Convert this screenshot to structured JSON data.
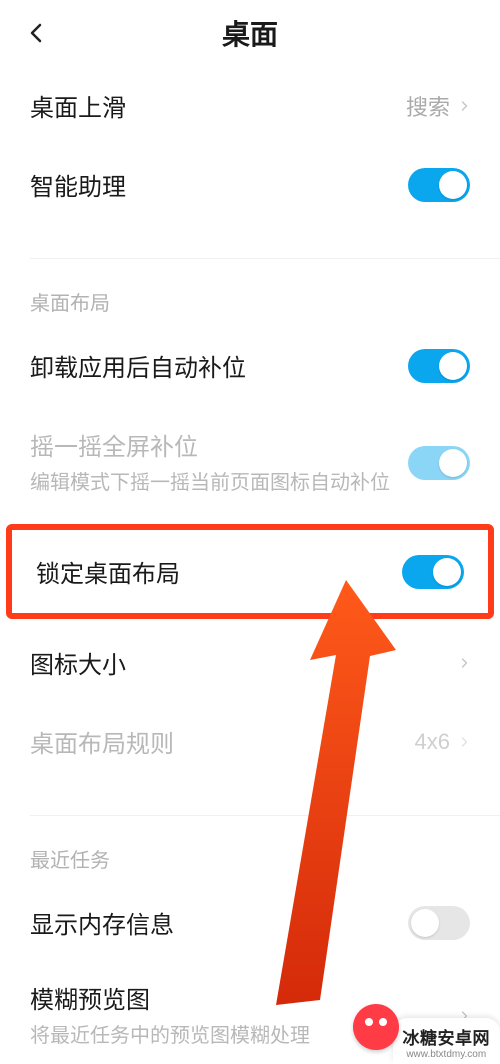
{
  "header": {
    "title": "桌面"
  },
  "rows": {
    "swipe_up": {
      "label": "桌面上滑",
      "value": "搜索"
    },
    "assistant": {
      "label": "智能助理"
    },
    "layout_header": "桌面布局",
    "auto_fill": {
      "label": "卸载应用后自动补位"
    },
    "shake_fill": {
      "label": "摇一摇全屏补位",
      "sub": "编辑模式下摇一摇当前页面图标自动补位"
    },
    "lock_layout": {
      "label": "锁定桌面布局"
    },
    "icon_size": {
      "label": "图标大小"
    },
    "layout_rule": {
      "label": "桌面布局规则",
      "value": "4x6"
    },
    "recent_header": "最近任务",
    "mem_info": {
      "label": "显示内存信息"
    },
    "blur": {
      "label": "模糊预览图",
      "sub": "将最近任务中的预览图模糊处理"
    }
  },
  "toggles": {
    "assistant": true,
    "auto_fill": true,
    "shake_fill": true,
    "lock_layout": true,
    "mem_info": false
  },
  "watermark": {
    "cn": "冰糖安卓网",
    "url": "www.btxtdmy.com"
  },
  "colors": {
    "accent": "#0aa7ef",
    "highlight": "#ff3b1a"
  }
}
